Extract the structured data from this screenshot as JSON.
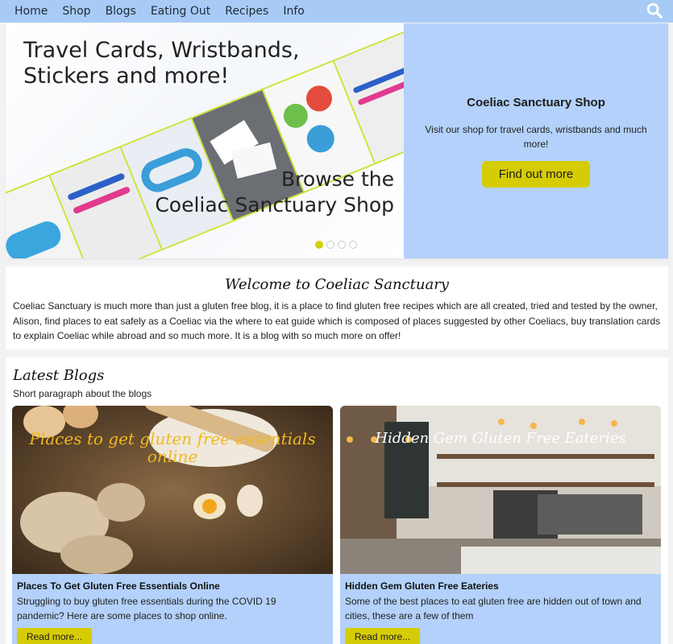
{
  "nav": {
    "items": [
      {
        "label": "Home"
      },
      {
        "label": "Shop"
      },
      {
        "label": "Blogs"
      },
      {
        "label": "Eating Out"
      },
      {
        "label": "Recipes"
      },
      {
        "label": "Info"
      }
    ],
    "search_icon": "search-icon"
  },
  "hero": {
    "banner_title_line1": "Travel Cards, Wristbands,",
    "banner_title_line2": "Stickers and more!",
    "banner_browse_line1": "Browse the",
    "banner_browse_line2": "Coeliac Sanctuary Shop",
    "side_title": "Coeliac Sanctuary Shop",
    "side_text": "Visit our shop for travel cards, wristbands and much more!",
    "side_button": "Find out more",
    "slide_count": 4,
    "active_slide": 1
  },
  "welcome": {
    "title": "Welcome to Coeliac Sanctuary",
    "text": "Coeliac Sanctuary is much more than just a gluten free blog, it is a place to find gluten free recipes which are all created, tried and tested by the owner, Alison, find places to eat safely as a Coeliac via the where to eat guide which is composed of places suggested by other Coeliacs, buy translation cards to explain Coeliac while abroad and so much more. It is a blog with so much more on offer!"
  },
  "blogs": {
    "title": "Latest Blogs",
    "subtitle": "Short paragraph about the blogs",
    "cards": [
      {
        "image_text": "Places to get gluten free essentials online",
        "title": "Places To Get Gluten Free Essentials Online",
        "text": "Struggling to buy gluten free essentials during the COVID 19 pandemic? Here are some places to shop online.",
        "button": "Read more..."
      },
      {
        "image_text": "Hidden Gem Gluten Free Eateries",
        "title": "Hidden Gem Gluten Free Eateries",
        "text": "Some of the best places to eat gluten free are hidden out of town and cities, these are a few of them",
        "button": "Read more..."
      }
    ]
  },
  "colors": {
    "nav_bg": "#a8cbf6",
    "panel_bg": "#b3d1fa",
    "accent": "#d6cc06"
  }
}
